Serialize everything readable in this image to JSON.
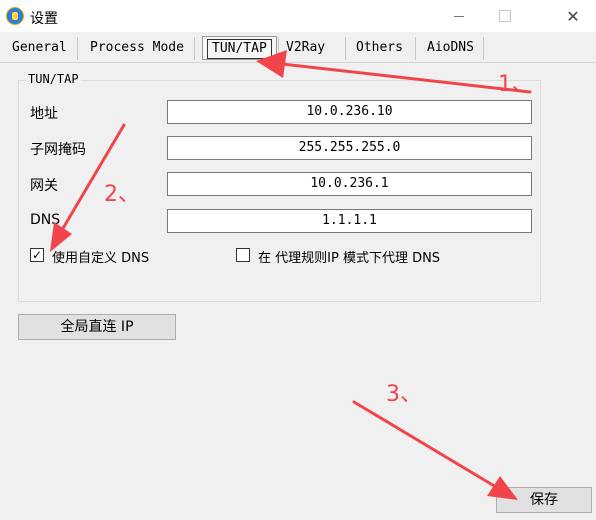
{
  "window": {
    "title": "设置",
    "close_glyph": "✕"
  },
  "tabs": [
    {
      "label": "General"
    },
    {
      "label": "Process Mode"
    },
    {
      "label": "TUN/TAP"
    },
    {
      "label": "V2Ray"
    },
    {
      "label": "Others"
    },
    {
      "label": "AioDNS"
    }
  ],
  "active_tab": "TUN/TAP",
  "group": {
    "title": "TUN/TAP",
    "fields": [
      {
        "label": "地址",
        "value": "10.0.236.10"
      },
      {
        "label": "子网掩码",
        "value": "255.255.255.0"
      },
      {
        "label": "网关",
        "value": "10.0.236.1"
      },
      {
        "label": "DNS",
        "value": "1.1.1.1"
      }
    ],
    "custom_dns": {
      "label": "使用自定义 DNS",
      "checked": true,
      "mark": "✓"
    },
    "proxy_dns": {
      "label": "在 代理规则IP 模式下代理 DNS",
      "checked": false
    }
  },
  "buttons": {
    "global_direct": "全局直连 IP",
    "save": "保存"
  },
  "annotations": [
    {
      "label": "1、"
    },
    {
      "label": "2、"
    },
    {
      "label": "3、"
    }
  ],
  "colors": {
    "annotation": "#f0464b",
    "window_bg": "#f0f0f0"
  }
}
